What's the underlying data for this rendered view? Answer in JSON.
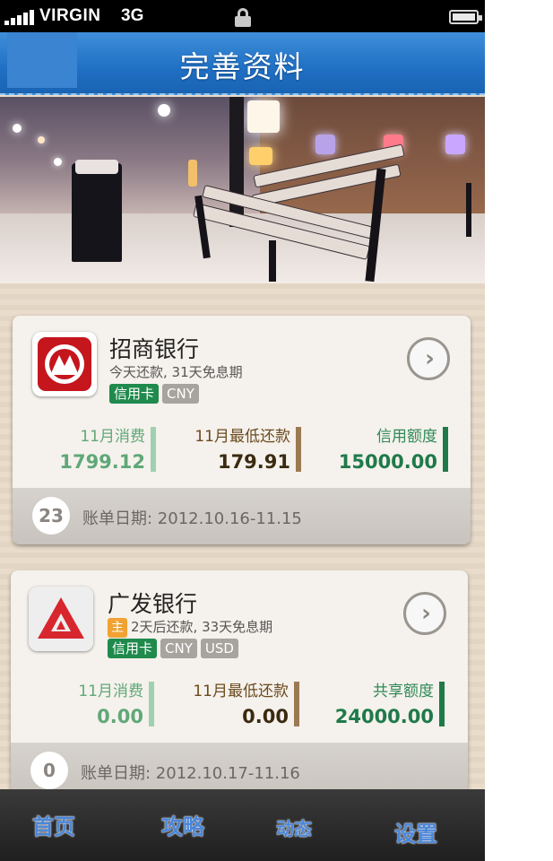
{
  "status_bar": {
    "carrier": "VIRGIN",
    "network": "3G"
  },
  "header": {
    "title": "完善资料"
  },
  "cards": [
    {
      "bank_name": "招商银行",
      "subtitle": "今天还款, 31天免息期",
      "badge": "",
      "tags": [
        "信用卡",
        "CNY"
      ],
      "stats": [
        {
          "label": "11月消费",
          "value": "1799.12"
        },
        {
          "label": "11月最低还款",
          "value": "179.91"
        },
        {
          "label": "信用额度",
          "value": "15000.00"
        }
      ],
      "days": "23",
      "billing_period": "账单日期: 2012.10.16-11.15",
      "logo_color": "#c4161c"
    },
    {
      "bank_name": "广发银行",
      "subtitle": "2天后还款, 33天免息期",
      "badge": "主",
      "tags": [
        "信用卡",
        "CNY",
        "USD"
      ],
      "stats": [
        {
          "label": "11月消费",
          "value": "0.00"
        },
        {
          "label": "11月最低还款",
          "value": "0.00"
        },
        {
          "label": "共享额度",
          "value": "24000.00"
        }
      ],
      "days": "0",
      "billing_period": "账单日期: 2012.10.17-11.16",
      "logo_color": "#d8262e"
    }
  ],
  "tab_bar": {
    "tabs": [
      "首页",
      "攻略",
      "动态",
      "设置"
    ]
  },
  "colors": {
    "header_blue": "#2a78c9",
    "stat_green": "#5fa878",
    "stat_brown": "#6b4a1e",
    "stat_darkgreen": "#1f7a4a"
  }
}
